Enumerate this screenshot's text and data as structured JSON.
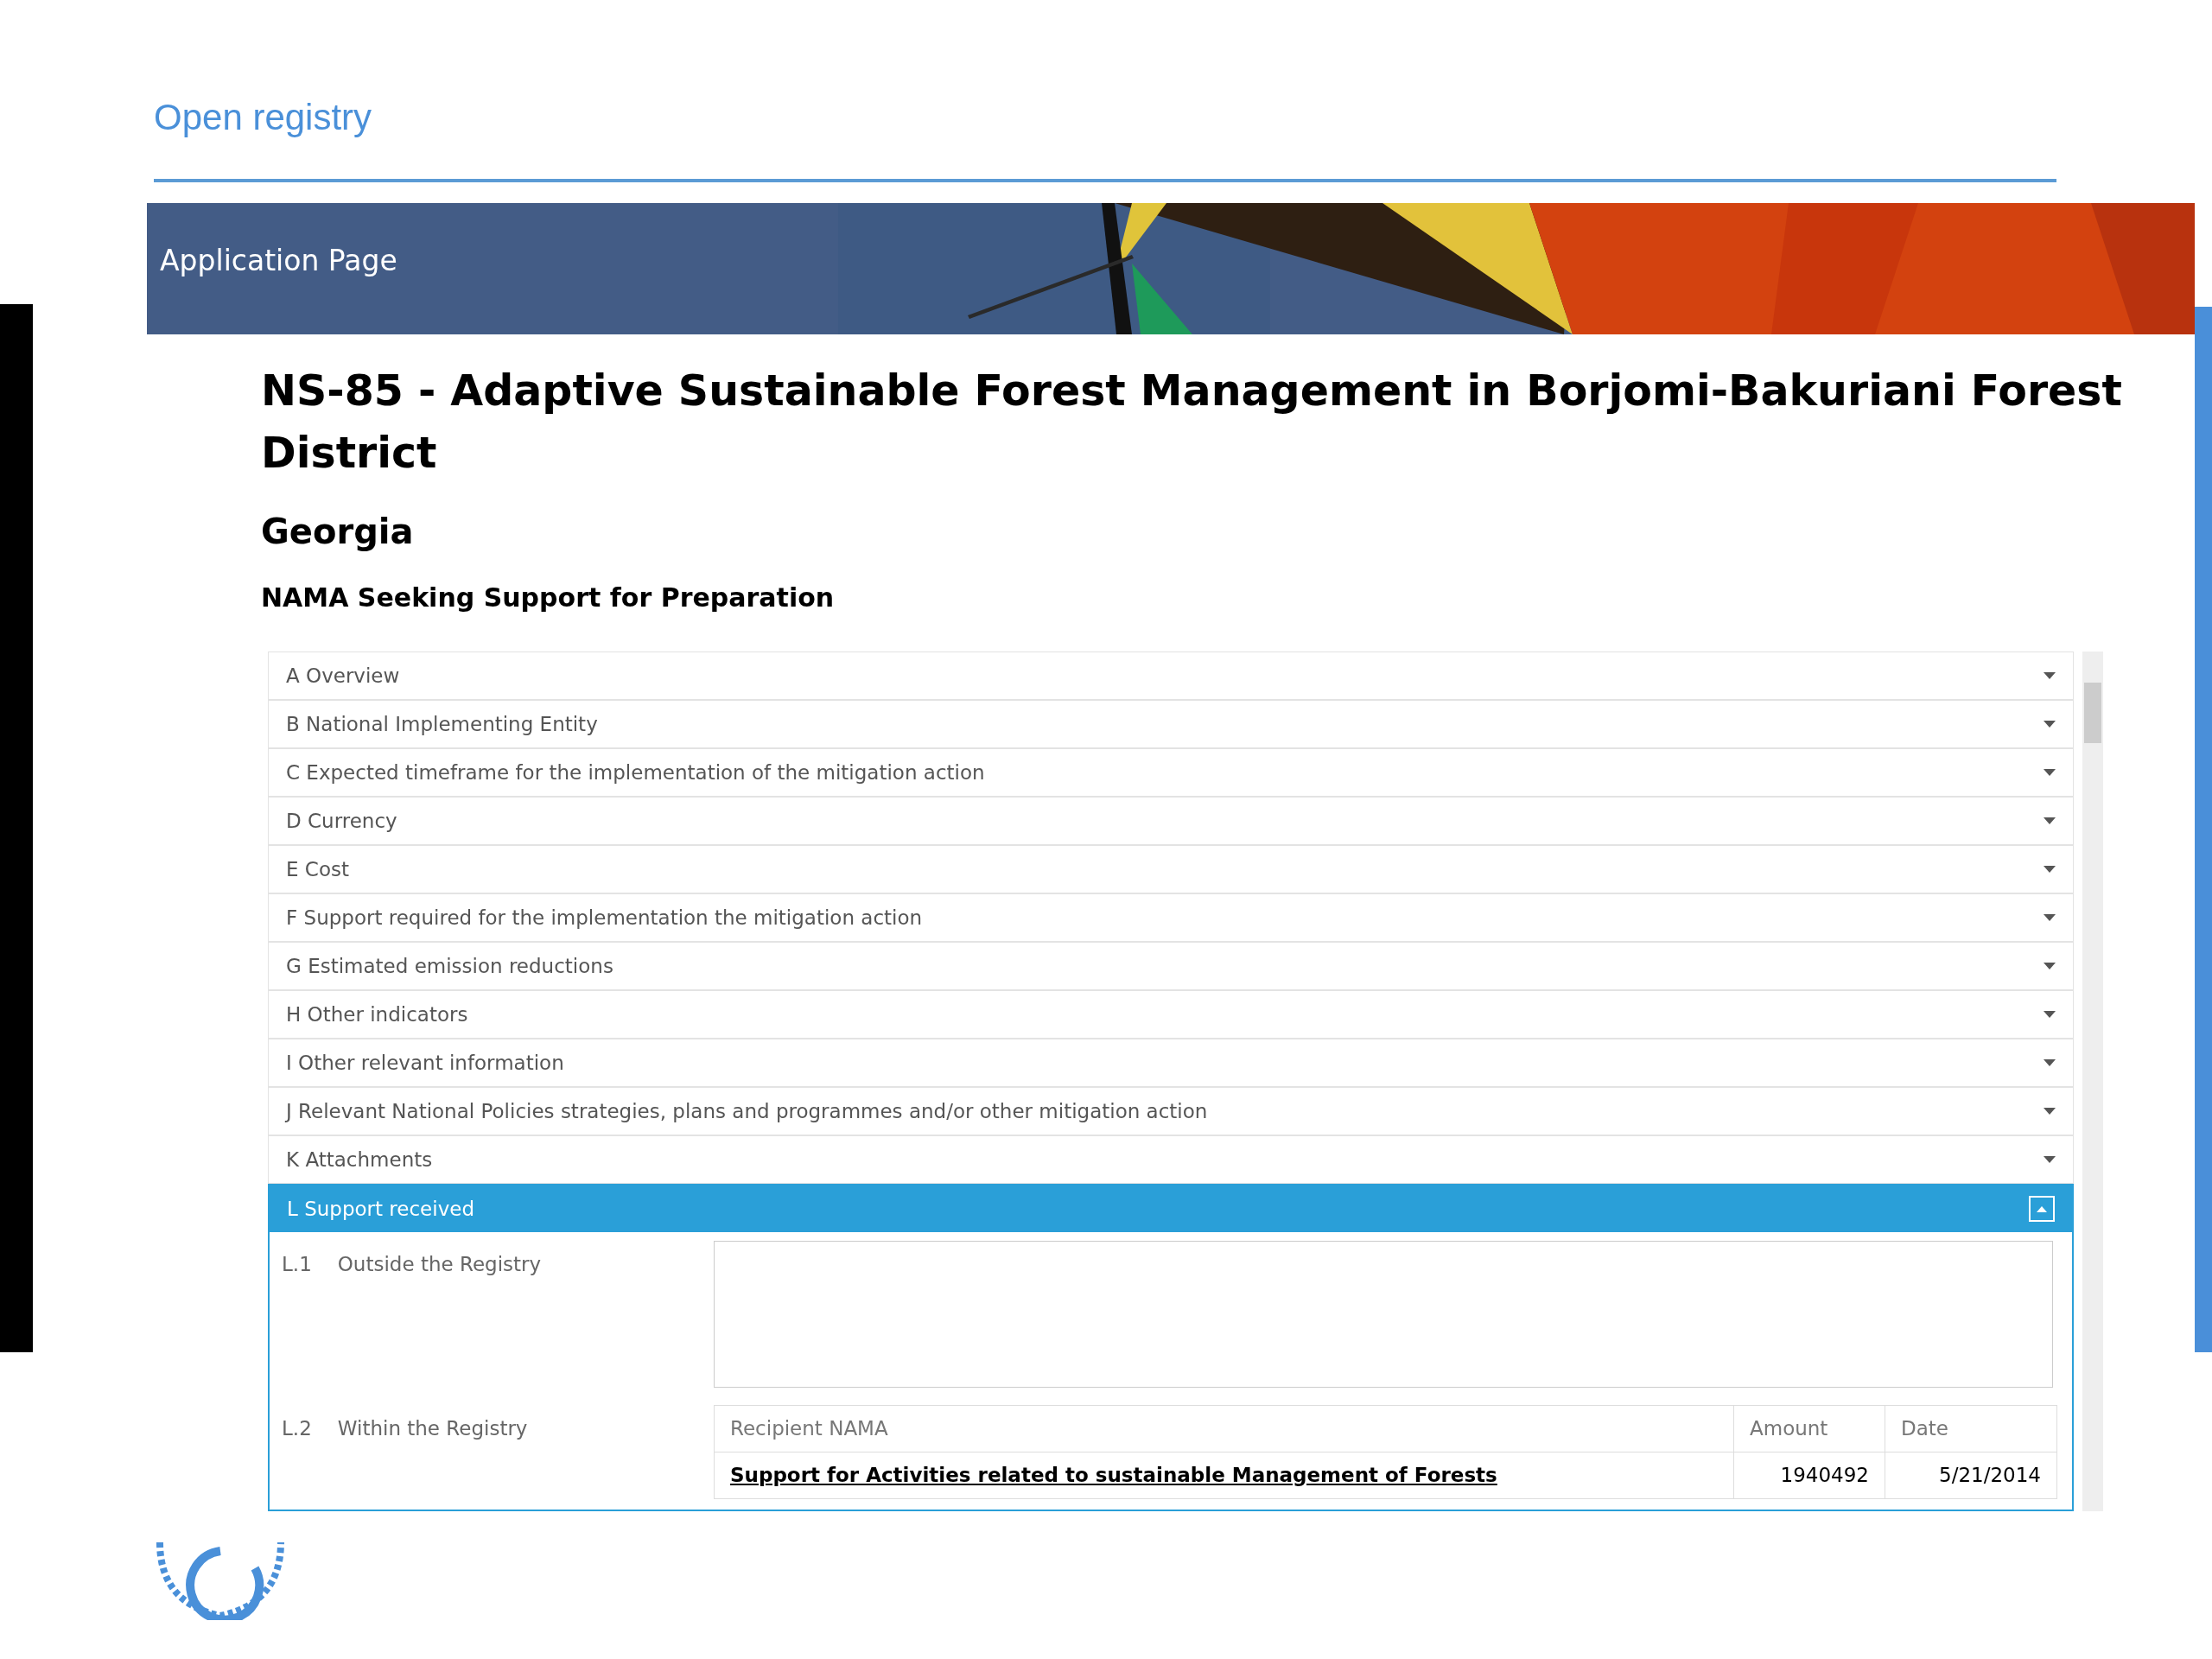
{
  "slide": {
    "title": "Open registry"
  },
  "banner": {
    "title": "Application Page"
  },
  "page": {
    "title": "NS-85 - Adaptive Sustainable Forest Management in Borjomi-Bakuriani Forest District",
    "country": "Georgia",
    "subtitle": "NAMA Seeking Support for Preparation"
  },
  "sections": [
    {
      "label": "A Overview",
      "expanded": false
    },
    {
      "label": "B National Implementing Entity",
      "expanded": false
    },
    {
      "label": "C Expected timeframe for the implementation of the mitigation action",
      "expanded": false
    },
    {
      "label": "D Currency",
      "expanded": false
    },
    {
      "label": "E Cost",
      "expanded": false
    },
    {
      "label": "F Support required for the implementation the mitigation action",
      "expanded": false
    },
    {
      "label": "G Estimated emission reductions",
      "expanded": false
    },
    {
      "label": "H Other indicators",
      "expanded": false
    },
    {
      "label": "I Other relevant information",
      "expanded": false
    },
    {
      "label": "J Relevant National Policies strategies, plans and programmes and/or other mitigation action",
      "expanded": false
    },
    {
      "label": "K Attachments",
      "expanded": false
    },
    {
      "label": "L Support received",
      "expanded": true
    }
  ],
  "support_received": {
    "outside": {
      "number": "L.1",
      "label": "Outside the Registry"
    },
    "within": {
      "number": "L.2",
      "label": "Within the Registry"
    },
    "table": {
      "columns": [
        "Recipient NAMA",
        "Amount",
        "Date"
      ],
      "rows": [
        {
          "recipient": "Support for Activities related to sustainable Management of Forests",
          "amount": "1940492",
          "date": "5/21/2014"
        }
      ]
    }
  }
}
